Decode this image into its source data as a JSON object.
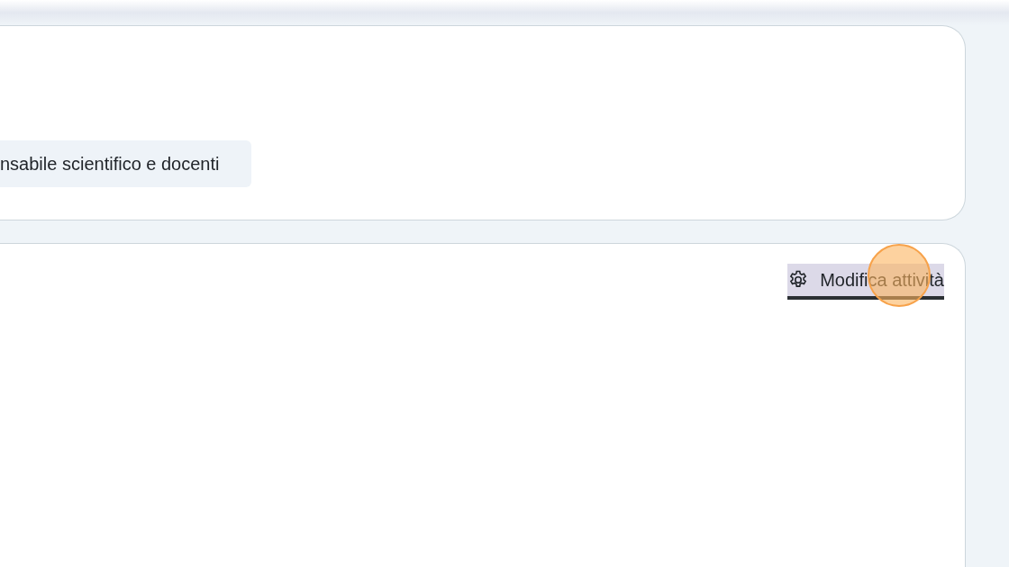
{
  "summary_card": {
    "tag": "nsabile scientifico e docenti"
  },
  "activity_card": {
    "edit_link": {
      "label": "Modifica attività",
      "focused": true
    }
  }
}
